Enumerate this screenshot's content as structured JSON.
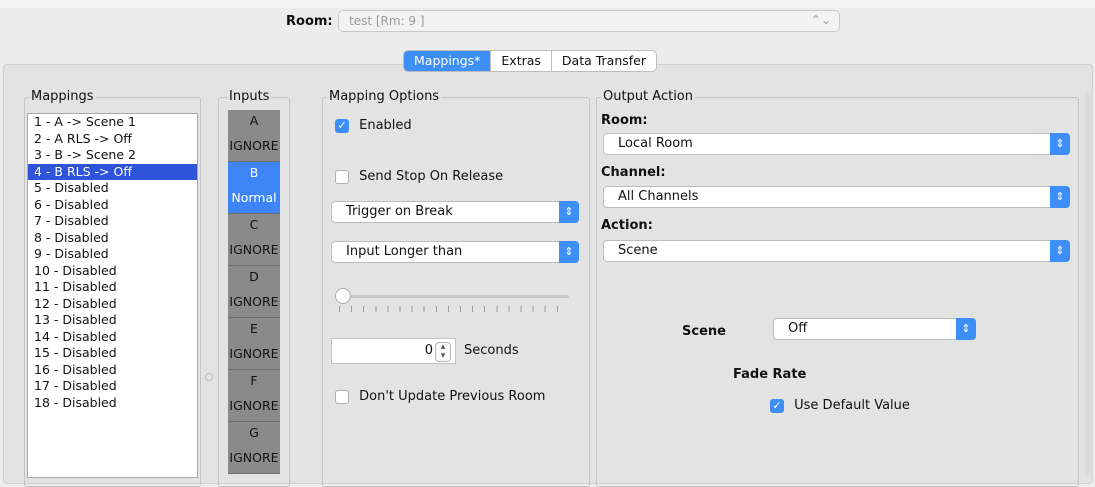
{
  "header": {
    "room_label": "Room:",
    "room_value": "test [Rm: 9 ]"
  },
  "tabs": [
    {
      "label": "Mappings*",
      "active": true
    },
    {
      "label": "Extras",
      "active": false
    },
    {
      "label": "Data Transfer",
      "active": false
    }
  ],
  "mappings": {
    "title": "Mappings",
    "items": [
      "1 - A -> Scene 1",
      "2 - A RLS -> Off",
      "3 - B -> Scene 2",
      "4 - B RLS -> Off",
      "5 - Disabled",
      "6 - Disabled",
      "7 - Disabled",
      "8 - Disabled",
      "9 - Disabled",
      "10 - Disabled",
      "11 - Disabled",
      "12 - Disabled",
      "13 - Disabled",
      "14 - Disabled",
      "15 - Disabled",
      "16 - Disabled",
      "17 - Disabled",
      "18 - Disabled"
    ],
    "selected_index": 3
  },
  "inputs": {
    "title": "Inputs",
    "items": [
      {
        "letter": "A",
        "mode": "IGNORE",
        "active": false
      },
      {
        "letter": "B",
        "mode": "Normal",
        "active": true
      },
      {
        "letter": "C",
        "mode": "IGNORE",
        "active": false
      },
      {
        "letter": "D",
        "mode": "IGNORE",
        "active": false
      },
      {
        "letter": "E",
        "mode": "IGNORE",
        "active": false
      },
      {
        "letter": "F",
        "mode": "IGNORE",
        "active": false
      },
      {
        "letter": "G",
        "mode": "IGNORE",
        "active": false
      }
    ]
  },
  "mapping_options": {
    "title": "Mapping Options",
    "enabled_label": "Enabled",
    "enabled_checked": true,
    "send_stop_label": "Send Stop On Release",
    "send_stop_checked": false,
    "trigger_select": "Trigger on Break",
    "input_select": "Input Longer than",
    "seconds_value": "0",
    "seconds_label": "Seconds",
    "dont_update_label": "Don't Update Previous Room",
    "dont_update_checked": false
  },
  "output_action": {
    "title": "Output Action",
    "room_label": "Room:",
    "room_value": "Local Room",
    "channel_label": "Channel:",
    "channel_value": "All Channels",
    "action_label": "Action:",
    "action_value": "Scene",
    "scene_label": "Scene",
    "scene_value": "Off",
    "fade_rate_label": "Fade Rate",
    "use_default_label": "Use Default Value",
    "use_default_checked": true
  },
  "icons": {
    "popup_arrows": "up-down-chevron-icon",
    "checkmark": "check-icon"
  },
  "colors": {
    "accent": "#3d8ef7",
    "selection": "#2f54d8",
    "input_gray": "#8a8a8a"
  }
}
